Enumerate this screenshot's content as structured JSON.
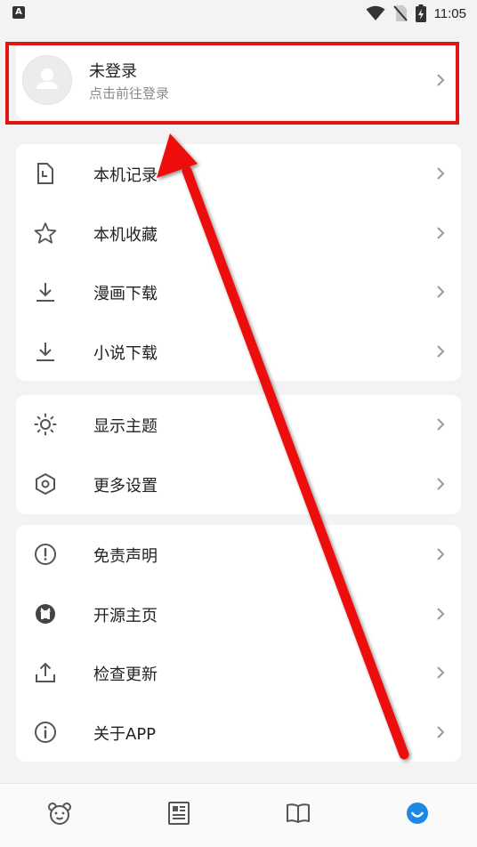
{
  "status": {
    "time": "11:05",
    "left_badge": "A"
  },
  "profile": {
    "title": "未登录",
    "subtitle": "点击前往登录"
  },
  "groups": {
    "local": [
      {
        "label": "本机记录",
        "icon": "history-file-icon"
      },
      {
        "label": "本机收藏",
        "icon": "star-icon"
      },
      {
        "label": "漫画下载",
        "icon": "download-icon"
      },
      {
        "label": "小说下载",
        "icon": "download-icon"
      }
    ],
    "settings": [
      {
        "label": "显示主题",
        "icon": "sun-icon"
      },
      {
        "label": "更多设置",
        "icon": "hexagon-settings-icon"
      }
    ],
    "about": [
      {
        "label": "免责声明",
        "icon": "alert-circle-icon"
      },
      {
        "label": "开源主页",
        "icon": "github-icon"
      },
      {
        "label": "检查更新",
        "icon": "upload-icon"
      },
      {
        "label": "关于APP",
        "icon": "info-circle-icon"
      }
    ]
  },
  "tabbar": {
    "active_color": "#1e88e5",
    "items": [
      "bear-icon",
      "news-icon",
      "book-icon",
      "smile-icon"
    ]
  },
  "annotation_color": "#e01616"
}
